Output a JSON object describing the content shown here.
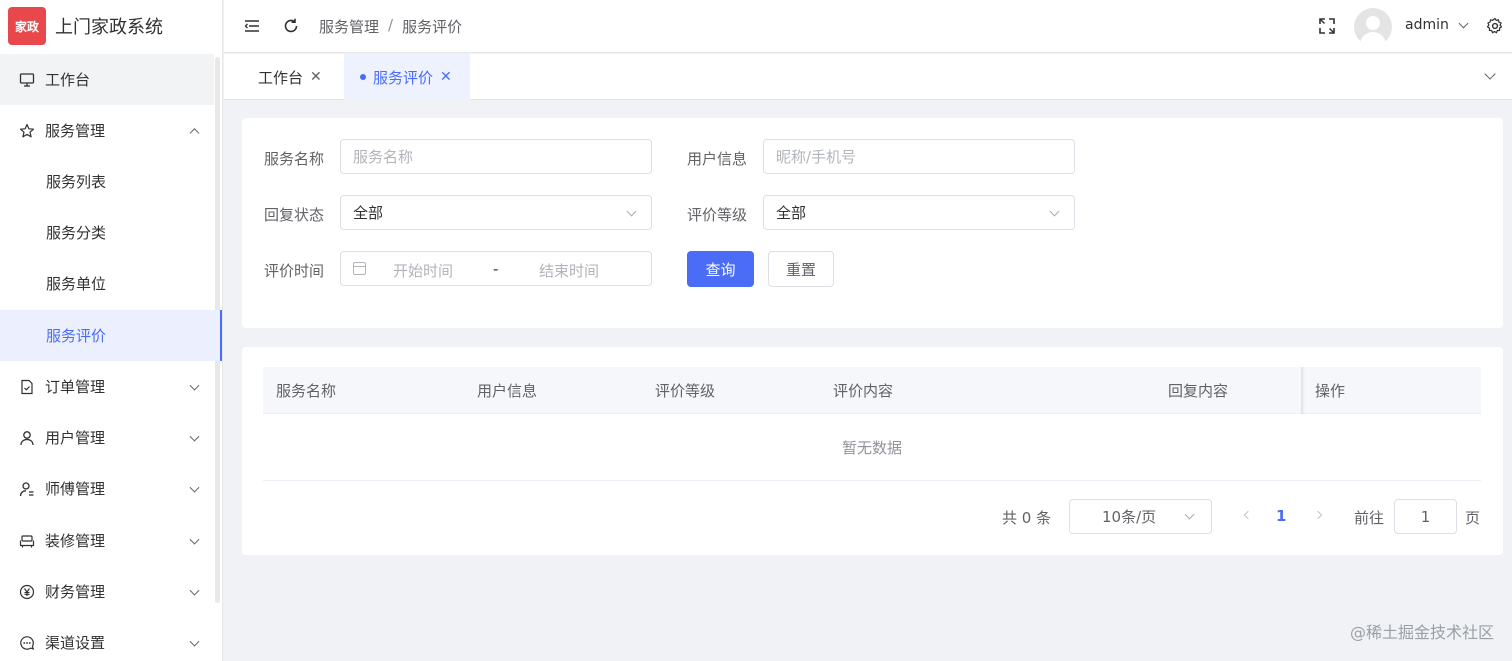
{
  "app": {
    "logo_text": "家政",
    "title": "上门家政系统",
    "brand_color": "#e8474c",
    "accent_color": "#4a6cf7"
  },
  "sidebar": {
    "items": [
      {
        "label": "工作台",
        "icon": "monitor-icon"
      },
      {
        "label": "服务管理",
        "icon": "star-icon",
        "expanded": true
      },
      {
        "label": "服务列表"
      },
      {
        "label": "服务分类"
      },
      {
        "label": "服务单位"
      },
      {
        "label": "服务评价",
        "active": true
      },
      {
        "label": "订单管理",
        "icon": "document-icon"
      },
      {
        "label": "用户管理",
        "icon": "user-icon"
      },
      {
        "label": "师傅管理",
        "icon": "worker-icon"
      },
      {
        "label": "装修管理",
        "icon": "sofa-icon"
      },
      {
        "label": "财务管理",
        "icon": "yen-icon"
      },
      {
        "label": "渠道设置",
        "icon": "chat-icon"
      }
    ]
  },
  "header": {
    "breadcrumb": [
      "服务管理",
      "服务评价"
    ],
    "breadcrumb_sep": "/",
    "username": "admin"
  },
  "tabs": [
    {
      "label": "工作台",
      "close": "✕"
    },
    {
      "label": "服务评价",
      "close": "✕",
      "active": true
    }
  ],
  "filters": {
    "service_name": {
      "label": "服务名称",
      "placeholder": "服务名称"
    },
    "user_info": {
      "label": "用户信息",
      "placeholder": "昵称/手机号"
    },
    "reply_status": {
      "label": "回复状态",
      "value": "全部"
    },
    "rating_level": {
      "label": "评价等级",
      "value": "全部"
    },
    "rating_time": {
      "label": "评价时间",
      "start_placeholder": "开始时间",
      "end_placeholder": "结束时间",
      "separator": "-"
    },
    "search_label": "查询",
    "reset_label": "重置"
  },
  "table": {
    "columns": [
      "服务名称",
      "用户信息",
      "评价等级",
      "评价内容",
      "回复内容",
      "操作"
    ],
    "rows": [],
    "empty_text": "暂无数据"
  },
  "pagination": {
    "total_text": "共 0 条",
    "page_size": "10条/页",
    "current_page": "1",
    "goto_label": "前往",
    "goto_value": "1",
    "page_suffix": "页"
  },
  "watermark": "@稀土掘金技术社区"
}
